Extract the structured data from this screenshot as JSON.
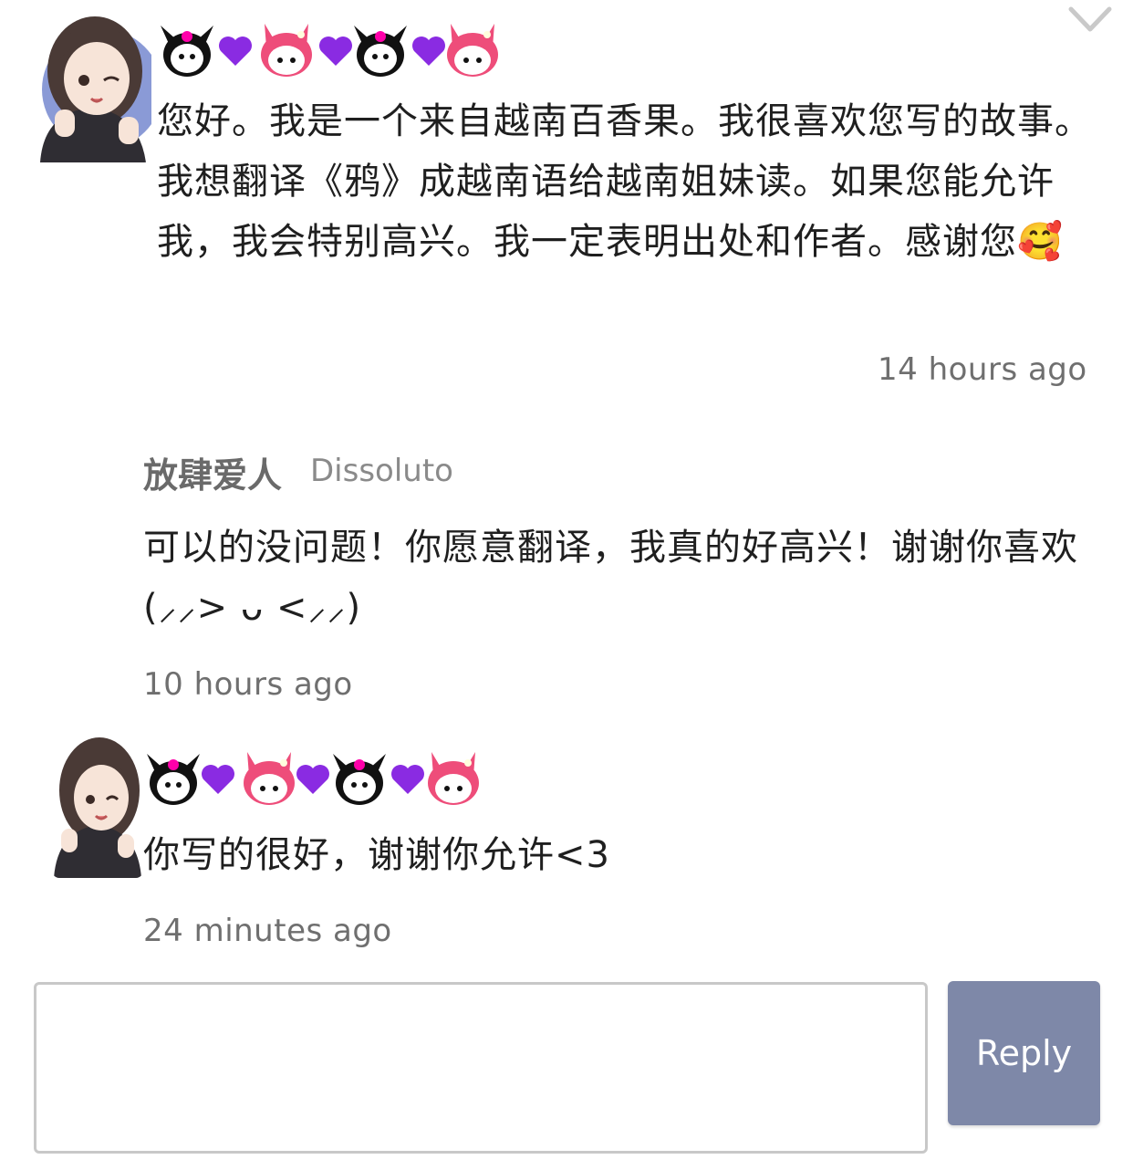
{
  "colors": {
    "timestamp": "#6f6f6f",
    "reply_button_bg": "#7e88a8",
    "input_border": "#c8c8c8",
    "reply_author": "#6a6a6a"
  },
  "header": {
    "collapse_icon": "chevron-down-icon"
  },
  "comments": [
    {
      "username_icons": [
        "kuromi-icon",
        "purple-heart-icon",
        "my-melody-icon",
        "purple-heart-icon",
        "kuromi-icon",
        "purple-heart-icon",
        "my-melody-icon"
      ],
      "text": "您好。我是一个来自越南百香果。我很喜欢您写的故事。我想翻译《鸦》成越南语给越南姐妹读。如果您能允许我，我会特别高兴。我一定表明出处和作者。感谢您🥰",
      "timestamp": "14 hours ago"
    },
    {
      "author": "放肆爱人",
      "handle": "Dissoluto",
      "text": "可以的没问题！你愿意翻译，我真的好高兴！谢谢你喜欢(⸝⸝> ᴗ <⸝⸝)",
      "timestamp": "10 hours ago"
    },
    {
      "username_icons": [
        "kuromi-icon",
        "purple-heart-icon",
        "my-melody-icon",
        "purple-heart-icon",
        "kuromi-icon",
        "purple-heart-icon",
        "my-melody-icon"
      ],
      "text": "你写的很好，谢谢你允许<3",
      "timestamp": "24 minutes ago"
    }
  ],
  "composer": {
    "placeholder": "",
    "value": "",
    "reply_label": "Reply"
  }
}
